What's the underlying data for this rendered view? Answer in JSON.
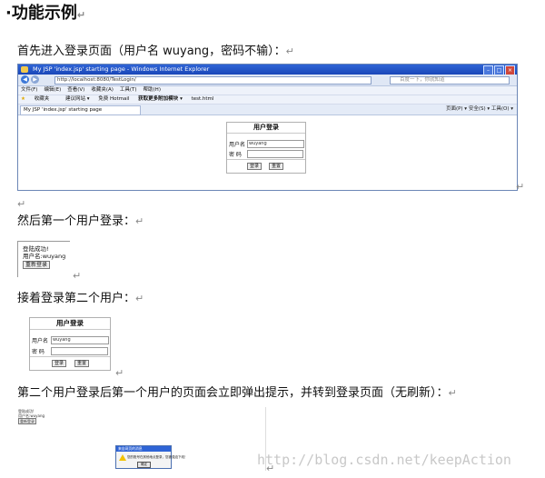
{
  "heading": "功能示例",
  "return_mark": "↵",
  "para1": "首先进入登录页面（用户名 wuyang，密码不输）：",
  "para2": "然后第一个用户登录：",
  "para3": "接着登录第二个用户：",
  "para4": "第二个用户登录后第一个用户的页面会立即弹出提示，并转到登录页面（无刷新）：",
  "watermark": "http://blog.csdn.net/keepAction",
  "browser": {
    "title": "My JSP 'index.jsp' starting page - Windows Internet Explorer",
    "address": "http://localhost:8080/TestLogin/",
    "search_placeholder": "百度一下，你就知道",
    "menu": [
      "文件(F)",
      "编辑(E)",
      "查看(V)",
      "收藏夹(A)",
      "工具(T)",
      "帮助(H)"
    ],
    "favorites": [
      "收藏夹",
      "建议网站 ▾",
      "免费 Hotmail",
      "获取更多附加模块 ▾",
      "test.html"
    ],
    "tab": "My JSP 'index.jsp' starting page",
    "tools": "页面(P) ▾  安全(S) ▾  工具(O) ▾"
  },
  "login": {
    "title": "用户登录",
    "user_label": "用户名",
    "pass_label": "密 码",
    "user_value": "wuyang",
    "submit": "登录",
    "reset": "重置"
  },
  "success": {
    "line1": "登陆成功!",
    "line2": "用户名:wuyang",
    "button": "重新登录"
  },
  "alert": {
    "title": "来自网页的消息",
    "message": "您的账号在其他地点登录，您被强迫下线！",
    "ok": "确定"
  },
  "colors": {
    "ie_title": "#2f64d6",
    "alert_icon": "#f2c200"
  }
}
